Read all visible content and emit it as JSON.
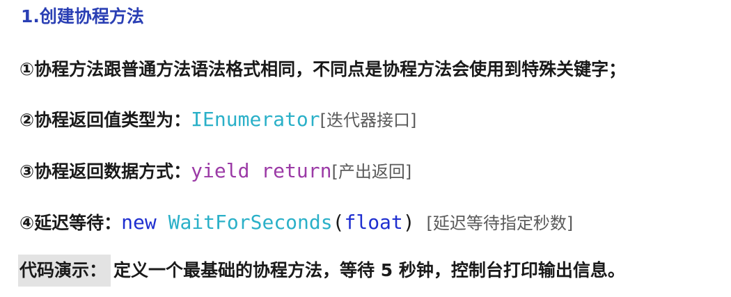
{
  "heading": "1.创建协程方法",
  "items": [
    {
      "text": "①协程方法跟普通方法语法格式相同，不同点是协程方法会使用到特殊关键字；"
    },
    {
      "label": "②协程返回值类型为：",
      "code_type": "IEnumerator",
      "note": "[迭代器接口]"
    },
    {
      "label": "③协程返回数据方式：",
      "code_kw": "yield return",
      "note": "[产出返回]"
    },
    {
      "label": "④延迟等待：",
      "code_new": "new",
      "code_type": "WaitForSeconds",
      "paren_open": "(",
      "code_arg": "float",
      "paren_close": ")",
      "note": "[延迟等待指定秒数]"
    }
  ],
  "demo": {
    "label": "代码演示：",
    "text": "定义一个最基础的协程方法，等待 5 秒钟，控制台打印输出信息。"
  },
  "colors": {
    "heading": "#2a3fb4",
    "type": "#2ab0c8",
    "keyword": "#9b3aa6",
    "new_keyword": "#1f2fd0",
    "note": "#5a5a5a",
    "demo_label_bg": "#e3e3e3"
  }
}
